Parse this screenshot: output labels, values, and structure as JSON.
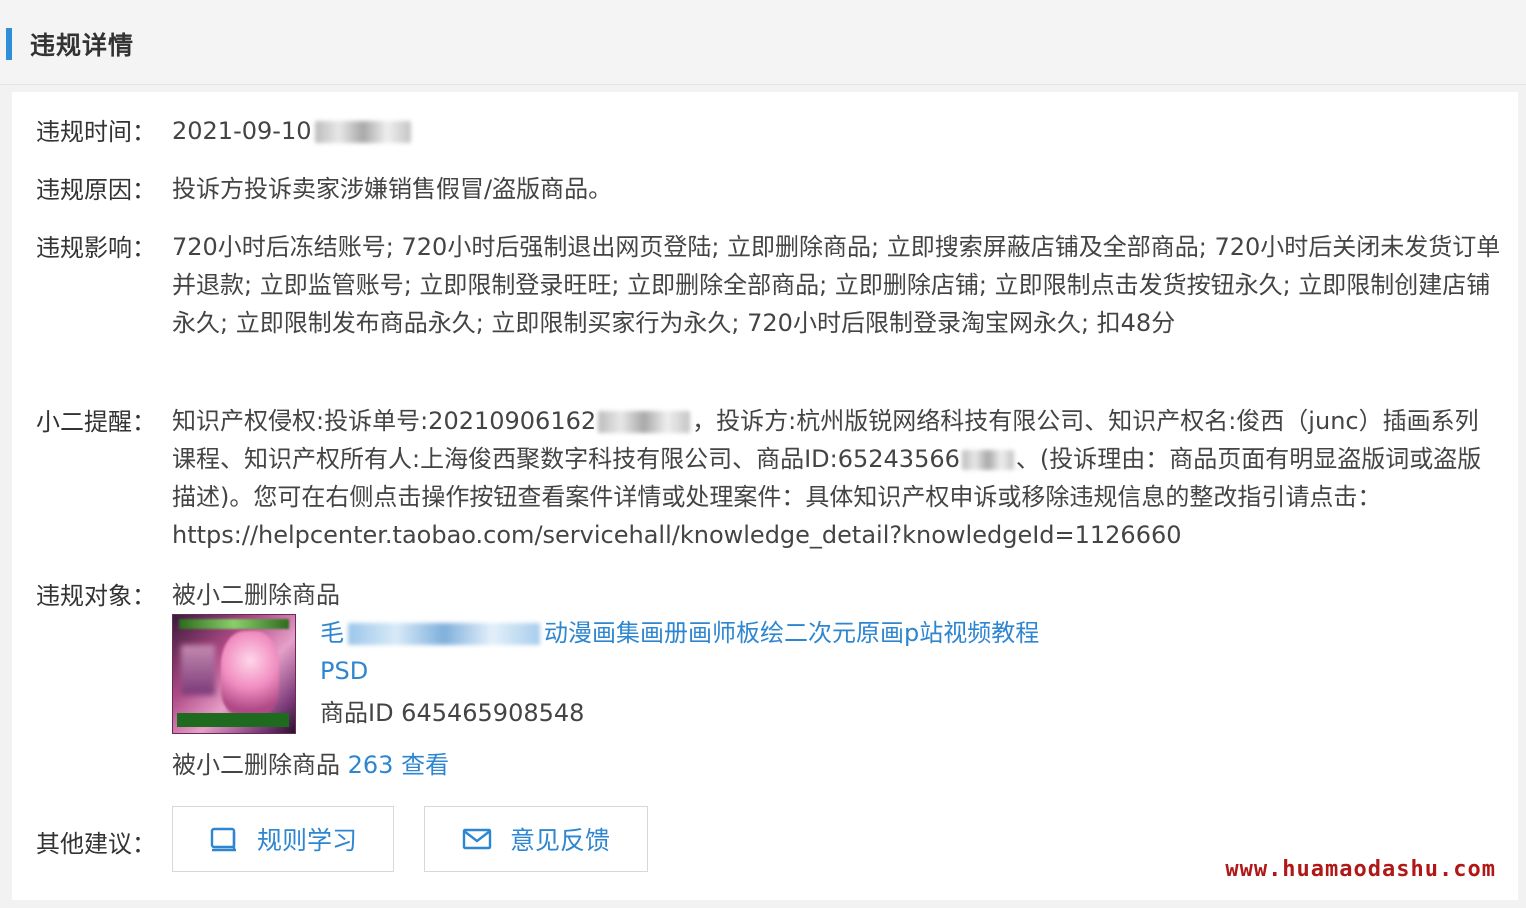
{
  "header": {
    "title": "违规详情"
  },
  "time": {
    "label": "违规时间：",
    "value": "2021-09-10"
  },
  "reason": {
    "label": "违规原因：",
    "value": "投诉方投诉卖家涉嫌销售假冒/盗版商品。"
  },
  "impact": {
    "label": "违规影响：",
    "value": "720小时后冻结账号; 720小时后强制退出网页登陆; 立即删除商品; 立即搜索屏蔽店铺及全部商品; 720小时后关闭未发货订单并退款; 立即监管账号; 立即限制登录旺旺; 立即删除全部商品; 立即删除店铺; 立即限制点击发货按钮永久; 立即限制创建店铺永久; 立即限制发布商品永久; 立即限制买家行为永久; 720小时后限制登录淘宝网永久; 扣48分"
  },
  "reminder": {
    "label": "小二提醒：",
    "part1": "知识产权侵权:投诉单号:20210906162",
    "part2": "，投诉方:杭州版锐网络科技有限公司、知识产权名:俊西（junc）插画系列课程、知识产权所有人:上海俊西聚数字科技有限公司、商品ID:65243566",
    "part3": "、(投诉理由：商品页面有明显盗版词或盗版描述)。您可在右侧点击操作按钮查看案件详情或处理案件：具体知识产权申诉或移除违规信息的整改指引请点击：",
    "url": "https://helpcenter.taobao.com/servicehall/knowledge_detail?knowledgeId=1126660"
  },
  "object": {
    "label": "违规对象：",
    "value": "被小二删除商品",
    "product_title_prefix": "毛",
    "product_title": "动漫画集画册画师板绘二次元原画p站视频教程",
    "product_title_line2": "PSD",
    "product_id": "商品ID 645465908548",
    "deleted_prefix": "被小二删除商品",
    "deleted_count": "263",
    "view_link": "查看"
  },
  "suggestions": {
    "label": "其他建议：",
    "rules_button": "规则学习",
    "feedback_button": "意见反馈"
  },
  "watermark": "www.huamaodashu.com",
  "colors": {
    "accent": "#2e8fd8",
    "link": "#2e86d1",
    "watermark": "#b01818"
  }
}
